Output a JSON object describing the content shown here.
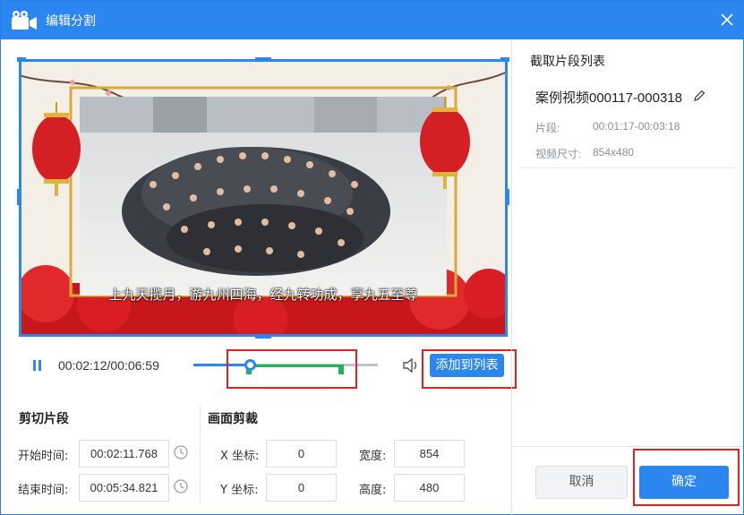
{
  "window": {
    "title": "编辑分割"
  },
  "video": {
    "subtitle": "上九天揽月，游九州四海，经九转功成，享九五至尊"
  },
  "player": {
    "time": "00:02:12/00:06:59",
    "played_fraction": 0.31,
    "range_start_fraction": 0.29,
    "range_end_fraction": 0.81,
    "add_to_list_label": "添加到列表"
  },
  "cut": {
    "title": "剪切片段",
    "start_label": "开始时间:",
    "start_value": "00:02:11.768",
    "end_label": "结束时间:",
    "end_value": "00:05:34.821"
  },
  "crop": {
    "title": "画面剪裁",
    "x_label": "X 坐标:",
    "x_value": "0",
    "y_label": "Y 坐标:",
    "y_value": "0",
    "width_label": "宽度:",
    "width_value": "854",
    "height_label": "高度:",
    "height_value": "480"
  },
  "clip_list": {
    "title": "截取片段列表",
    "items": [
      {
        "name": "案例视频000117-000318",
        "segment_label": "片段:",
        "segment_value": "00:01:17-00:03:18",
        "size_label": "视频尺寸:",
        "size_value": "854x480"
      }
    ]
  },
  "buttons": {
    "cancel": "取消",
    "confirm": "确定"
  },
  "colors": {
    "accent": "#2b86f0",
    "range": "#22b45a",
    "highlight_box": "#e52020"
  }
}
